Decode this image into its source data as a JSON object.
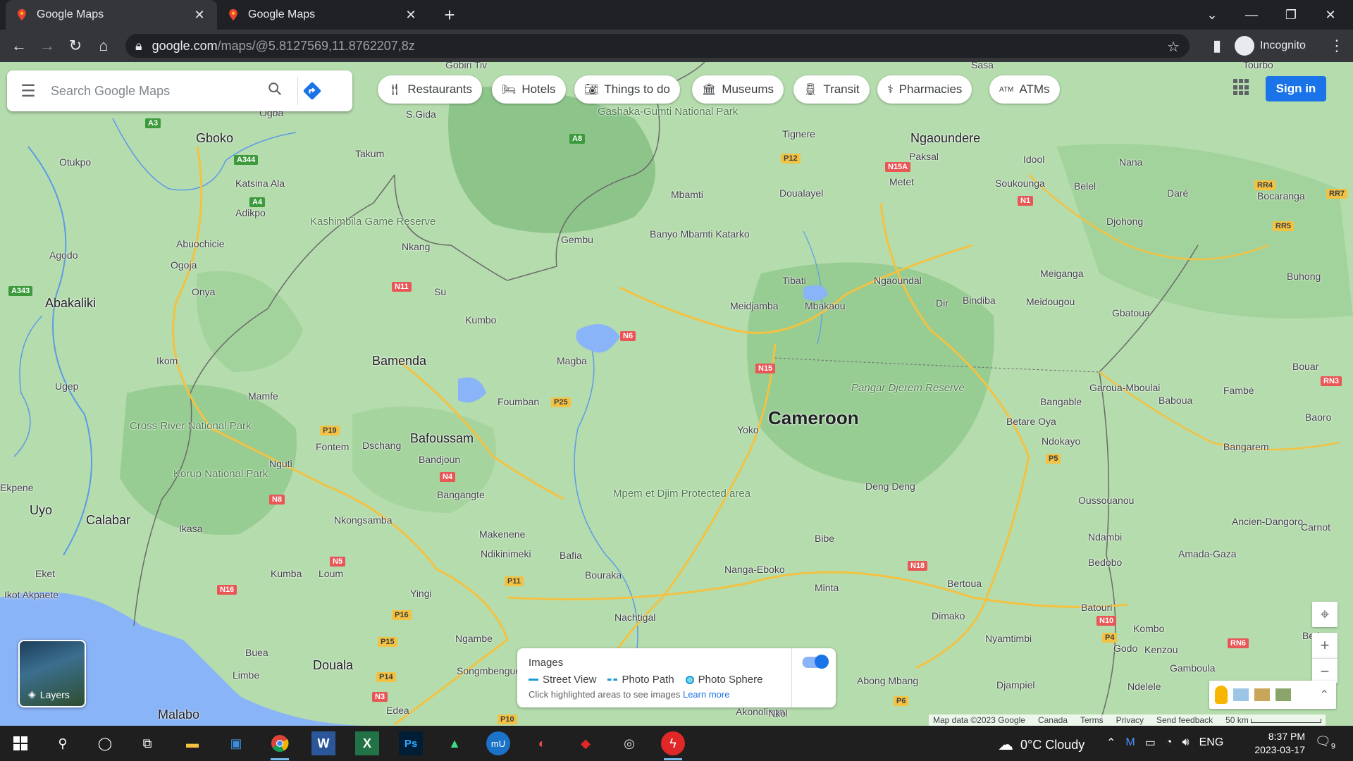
{
  "browser": {
    "tabs": [
      {
        "title": "Google Maps",
        "active": true
      },
      {
        "title": "Google Maps",
        "active": false
      }
    ],
    "new_tab": "+",
    "url_host": "google.com",
    "url_path": "/maps/@5.8127569,11.8762207,8z",
    "profile_label": "Incognito",
    "window_controls": {
      "chevron": "⌄",
      "minimize": "—",
      "maximize": "❐",
      "close": "✕"
    }
  },
  "maps": {
    "search_placeholder": "Search Google Maps",
    "chips": [
      {
        "label": "Restaurants",
        "icon": "fork-knife-icon"
      },
      {
        "label": "Hotels",
        "icon": "bed-icon"
      },
      {
        "label": "Things to do",
        "icon": "camera-icon"
      },
      {
        "label": "Museums",
        "icon": "museum-icon"
      },
      {
        "label": "Transit",
        "icon": "train-icon"
      },
      {
        "label": "Pharmacies",
        "icon": "pharmacy-icon"
      },
      {
        "label": "ATMs",
        "icon": "atm-icon"
      }
    ],
    "sign_in": "Sign in",
    "layers_label": "Layers",
    "images_panel": {
      "title": "Images",
      "legend": [
        "Street View",
        "Photo Path",
        "Photo Sphere"
      ],
      "hint": "Click highlighted areas to see images",
      "learn_more": "Learn more",
      "toggle_on": true
    },
    "attribution": [
      "Map data ©2023 Google",
      "Canada",
      "Terms",
      "Privacy",
      "Send feedback",
      "50 km"
    ],
    "places": {
      "country": "Cameroon",
      "cities": [
        "Bamenda",
        "Bafoussam",
        "Douala",
        "Calabar",
        "Uyo",
        "Abakaliki",
        "Malabo",
        "Ngaoundere",
        "Gboko"
      ],
      "towns": [
        "Gobiri Tiv",
        "Ogba",
        "S.Gida",
        "Otukpo",
        "Takum",
        "Katsina Ala",
        "Adikpo",
        "Abuochicie",
        "Agodo",
        "Ogoja",
        "Onya",
        "Ikom",
        "Ugep",
        "Mamfe",
        "Fontem",
        "Dschang",
        "Bangangte",
        "Bandjoun",
        "Nguti",
        "Ekpene",
        "Nkongsamba",
        "Ikasa",
        "Kumba",
        "Loum",
        "Eket",
        "Ikot Akpaete",
        "Buea",
        "Limbe",
        "Yingi",
        "Ngambe",
        "Songmbengue",
        "Edea",
        "Nkang",
        "Su",
        "Kumbo",
        "Foumban",
        "Magba",
        "Makenene",
        "Ndikinimeki",
        "Bafia",
        "Bouraka",
        "Nachtigal",
        "Gembu",
        "Mbamti",
        "Banyo Mbamti Katarko",
        "Tignere",
        "Paksal",
        "Metet",
        "Doualayel",
        "Tibati",
        "Meidjamba",
        "Mbakaou",
        "Ngaoundal",
        "Dir",
        "Bindiba",
        "Idool",
        "Soukounga",
        "Nana",
        "Belel",
        "Daré",
        "Bocaranga",
        "Djohong",
        "Meiganga",
        "Meidougou",
        "Gbatoua",
        "Buhong",
        "Garoua-Mboulai",
        "Baboua",
        "Fambé",
        "Bouar",
        "Baoro",
        "Bangable",
        "Betare Oya",
        "Ndokayo",
        "Bangarem",
        "Yoko",
        "Deng Deng",
        "Oussouanou",
        "Ancien-Dangoro",
        "Carnot",
        "Ndambi",
        "Bedobo",
        "Amada-Gaza",
        "Bibe",
        "Nanga-Eboko",
        "Minta",
        "Bertoua",
        "Dimako",
        "Batouri",
        "Kombo",
        "Godo",
        "Kenzou",
        "Gamboula",
        "Nyamtimbi",
        "Berbe",
        "Ndelele",
        "Djampiel",
        "Abong Mbang",
        "Akonolinga",
        "Nkol",
        "Tourbo",
        "Sasa"
      ],
      "parks": [
        "Gashaka-Gumti National Park",
        "Kashimbila Game Reserve",
        "Cross River National Park",
        "Korup National Park",
        "Mpem et Djim Protected area"
      ],
      "reserves": [
        "Pangar Djerem Reserve"
      ],
      "roads": [
        "A3",
        "A344",
        "A4",
        "A343",
        "A8",
        "N11",
        "N6",
        "N8",
        "N5",
        "N4",
        "N3",
        "N15",
        "N16",
        "P12",
        "P15",
        "P16",
        "P19",
        "P25",
        "P10",
        "P11",
        "P14",
        "P4",
        "P5",
        "P6",
        "N1",
        "N10",
        "N18",
        "N15A",
        "RR4",
        "RR5",
        "RR7",
        "RN3",
        "RN6"
      ]
    }
  },
  "taskbar": {
    "weather": "0°C  Cloudy",
    "language": "ENG",
    "time": "8:37 PM",
    "date": "2023-03-17",
    "notifications": "9"
  }
}
